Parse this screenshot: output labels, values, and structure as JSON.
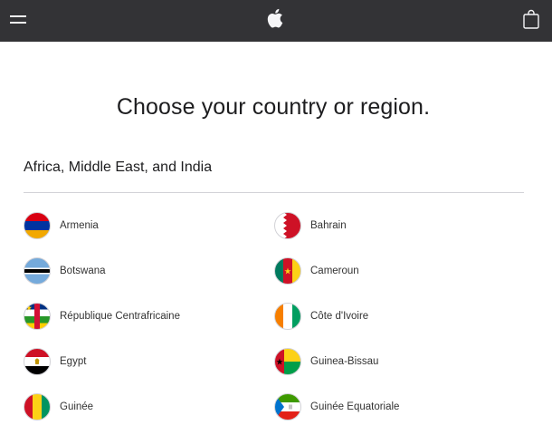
{
  "nav": {
    "menu_icon": "hamburger-menu-icon",
    "logo_icon": "apple-logo-icon",
    "bag_icon": "shopping-bag-icon"
  },
  "page": {
    "title": "Choose your country or region."
  },
  "section": {
    "title": "Africa, Middle East, and India"
  },
  "countries": {
    "left": [
      {
        "name": "Armenia",
        "flag": "armenia-flag-icon"
      },
      {
        "name": "Botswana",
        "flag": "botswana-flag-icon"
      },
      {
        "name": "République Centrafricaine",
        "flag": "central-african-republic-flag-icon"
      },
      {
        "name": "Egypt",
        "flag": "egypt-flag-icon"
      },
      {
        "name": "Guinée",
        "flag": "guinea-flag-icon"
      }
    ],
    "right": [
      {
        "name": "Bahrain",
        "flag": "bahrain-flag-icon"
      },
      {
        "name": "Cameroun",
        "flag": "cameroon-flag-icon"
      },
      {
        "name": "Côte d'Ivoire",
        "flag": "ivory-coast-flag-icon"
      },
      {
        "name": "Guinea-Bissau",
        "flag": "guinea-bissau-flag-icon"
      },
      {
        "name": "Guinée Equatoriale",
        "flag": "equatorial-guinea-flag-icon"
      }
    ]
  },
  "colors": {
    "nav_background": "#333336",
    "divider": "#d2d2d7"
  }
}
